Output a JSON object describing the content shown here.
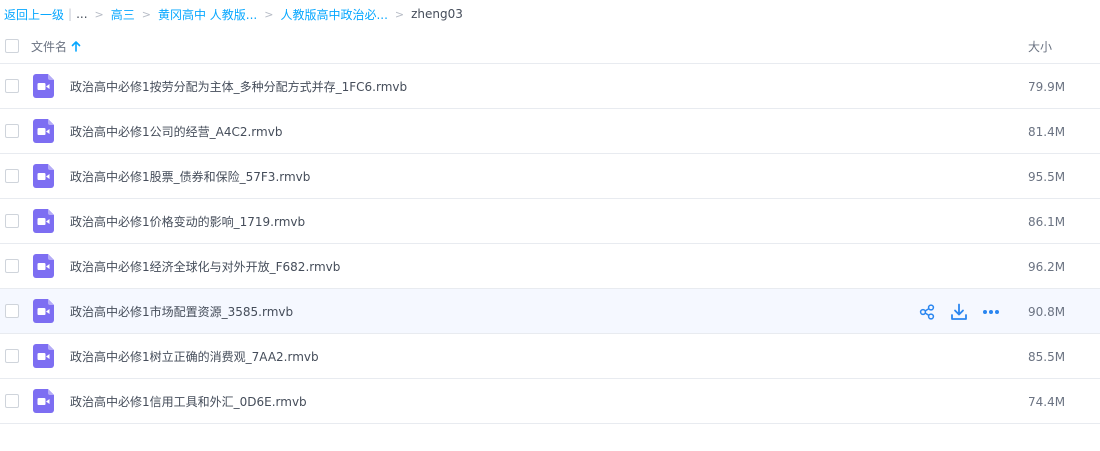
{
  "breadcrumb": {
    "back_label": "返回上一级",
    "separator": "|",
    "ellipsis": "...",
    "chevron": ">",
    "items": [
      "高三",
      "黄冈高中 人教版...",
      "人教版高中政治必..."
    ],
    "current": "zheng03"
  },
  "table": {
    "name_header": "文件名",
    "size_header": "大小",
    "sort_icon": "arrow-up-icon"
  },
  "files": [
    {
      "name": "政治高中必修1按劳分配为主体_多种分配方式并存_1FC6.rmvb",
      "size": "79.9M"
    },
    {
      "name": "政治高中必修1公司的经营_A4C2.rmvb",
      "size": "81.4M"
    },
    {
      "name": "政治高中必修1股票_债券和保险_57F3.rmvb",
      "size": "95.5M"
    },
    {
      "name": "政治高中必修1价格变动的影响_1719.rmvb",
      "size": "86.1M"
    },
    {
      "name": "政治高中必修1经济全球化与对外开放_F682.rmvb",
      "size": "96.2M"
    },
    {
      "name": "政治高中必修1市场配置资源_3585.rmvb",
      "size": "90.8M"
    },
    {
      "name": "政治高中必修1树立正确的消费观_7AA2.rmvb",
      "size": "85.5M"
    },
    {
      "name": "政治高中必修1信用工具和外汇_0D6E.rmvb",
      "size": "74.4M"
    }
  ],
  "hovered_row_actions": [
    "share-icon",
    "download-icon",
    "more-icon"
  ],
  "colors": {
    "accent": "#06a7ff",
    "video_icon": "#7d6ef2",
    "video_icon_fold": "#b5acf7",
    "action_icon": "#2a86f0",
    "hover_row": "#f5f8ff",
    "divider": "#e8ebf0"
  }
}
